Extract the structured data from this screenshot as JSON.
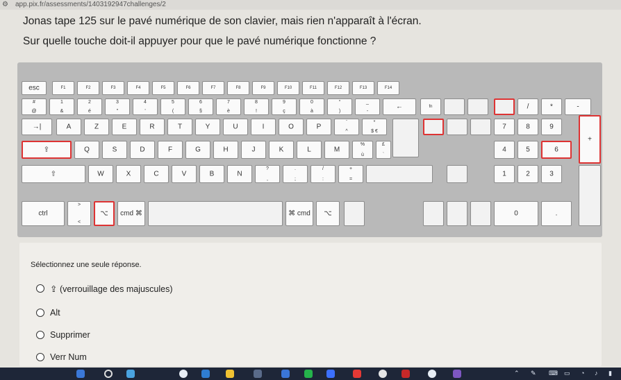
{
  "browser": {
    "url": "app.pix.fr/assessments/1403192947challenges/2"
  },
  "question": {
    "line1": "Jonas tape 125 sur le pavé numérique de son clavier, mais rien n'apparaît à l'écran.",
    "line2": "Sur quelle touche doit-il appuyer pour que le pavé numérique fonctionne ?"
  },
  "keyboard": {
    "row0": [
      "esc",
      "F1",
      "F2",
      "F3",
      "F4",
      "F5",
      "F6",
      "F7",
      "F8",
      "F9",
      "F10",
      "F11",
      "F12",
      "F13",
      "F14"
    ],
    "row1": [
      {
        "top": "#",
        "bot": "@"
      },
      {
        "top": "1",
        "bot": "&"
      },
      {
        "top": "2",
        "bot": "é"
      },
      {
        "top": "3",
        "bot": "\""
      },
      {
        "top": "4",
        "bot": "'"
      },
      {
        "top": "5",
        "bot": "("
      },
      {
        "top": "6",
        "bot": "§"
      },
      {
        "top": "7",
        "bot": "è"
      },
      {
        "top": "8",
        "bot": "!"
      },
      {
        "top": "9",
        "bot": "ç"
      },
      {
        "top": "0",
        "bot": "à"
      },
      {
        "top": "°",
        "bot": ")"
      },
      {
        "top": "_",
        "bot": "-"
      }
    ],
    "backspace": "←",
    "fn": "fn",
    "row2": [
      "A",
      "Z",
      "E",
      "R",
      "T",
      "Y",
      "U",
      "I",
      "O",
      "P"
    ],
    "row2extra": [
      {
        "top": "¨",
        "bot": "^"
      },
      {
        "top": "*",
        "bot": "$ €"
      }
    ],
    "tab": "→|",
    "row3": [
      "Q",
      "S",
      "D",
      "F",
      "G",
      "H",
      "J",
      "K",
      "L",
      "M"
    ],
    "row3extra": [
      {
        "top": "%",
        "bot": "ù"
      },
      {
        "top": "£",
        "bot": "`"
      }
    ],
    "capslock": "⇪",
    "row4": [
      "W",
      "X",
      "C",
      "V",
      "B",
      "N"
    ],
    "row4extra": [
      {
        "top": "?",
        "bot": ","
      },
      {
        "top": ".",
        "bot": ";"
      },
      {
        "top": "/",
        "bot": ":"
      },
      {
        "top": "+",
        "bot": "="
      }
    ],
    "shift": "⇧",
    "ctrl": "ctrl",
    "alt": "⌥",
    "cmd": "cmd ⌘",
    "cmd_right": "⌘ cmd",
    "alt_right": "⌥",
    "chevrons": {
      "top": ">",
      "bot": "<"
    },
    "numpad": [
      "/",
      "*",
      "-",
      "7",
      "8",
      "9",
      "+",
      "4",
      "5",
      "6",
      "1",
      "2",
      "3",
      "0",
      "."
    ]
  },
  "answers": {
    "instruction": "Sélectionnez une seule réponse.",
    "options": [
      "⇪ (verrouillage des majuscules)",
      "Alt",
      "Supprimer",
      "Verr Num"
    ]
  }
}
